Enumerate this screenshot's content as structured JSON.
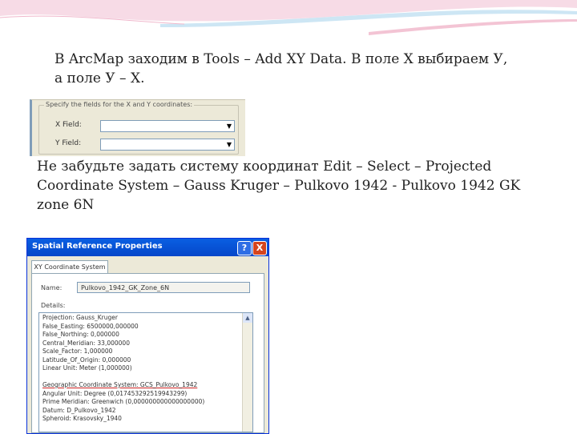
{
  "slide": {
    "line1": "В ArcMap заходим в Tools – Add XY Data. В поле X выбираем У,",
    "line2": "а поле У – Х.",
    "note1": "Не забудьте задать систему координат  Edit – Select – Projected",
    "note2": "Coordinate System – Gauss Kruger – Pulkovo 1942 - Pulkovo 1942  GK",
    "note3": "zone 6N"
  },
  "xy_dialog": {
    "group_label": "Specify the fields for the X and Y coordinates:",
    "x_label": "X Field:",
    "y_label": "Y Field:",
    "x_value": "",
    "y_value": ""
  },
  "spatial_ref": {
    "title": "Spatial Reference Properties",
    "help": "?",
    "close": "X",
    "tab": "XY Coordinate System",
    "name_label": "Name:",
    "name_value": "Pulkovo_1942_GK_Zone_6N",
    "details_label": "Details:",
    "details": [
      "Projection: Gauss_Kruger",
      "False_Easting: 6500000,000000",
      "False_Northing: 0,000000",
      "Central_Meridian: 33,000000",
      "Scale_Factor: 1,000000",
      "Latitude_Of_Origin: 0,000000",
      "Linear Unit: Meter (1,000000)",
      "",
      "Geographic Coordinate System: GCS_Pulkovo_1942",
      "Angular Unit: Degree (0,017453292519943299)",
      "Prime Meridian: Greenwich (0,000000000000000000)",
      "Datum: D_Pulkovo_1942",
      "  Spheroid: Krasovsky_1940"
    ]
  },
  "colors": {
    "titlebar": "#0a5fe2",
    "dialog_bg": "#ece9d8",
    "underline": "#cc2222"
  }
}
